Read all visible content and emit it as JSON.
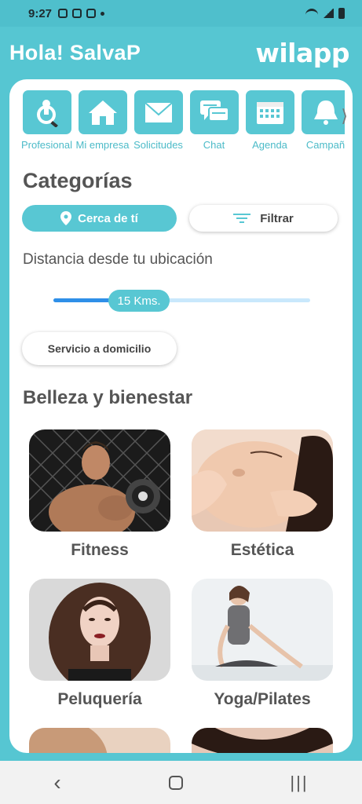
{
  "status": {
    "time": "9:27"
  },
  "header": {
    "greeting": "Hola! SalvaP",
    "logo": "wilapp"
  },
  "nav": {
    "items": [
      {
        "label": "Profesional",
        "icon": "person-search-icon"
      },
      {
        "label": "Mi empresa",
        "icon": "house-icon"
      },
      {
        "label": "Solicitudes",
        "icon": "envelope-icon"
      },
      {
        "label": "Chat",
        "icon": "chat-bubbles-icon"
      },
      {
        "label": "Agenda",
        "icon": "calendar-icon"
      },
      {
        "label": "Campañ",
        "icon": "bell-icon"
      }
    ],
    "more_arrow": "⟩"
  },
  "categories": {
    "title": "Categorías",
    "near_label": "Cerca de tí",
    "filter_label": "Filtrar",
    "distance_label": "Distancia desde tu ubicación",
    "distance_value": "15 Kms.",
    "distance_fraction": 0.22,
    "home_service_label": "Servicio a domicilio"
  },
  "section": {
    "title": "Belleza y bienestar",
    "items": [
      {
        "name": "Fitness"
      },
      {
        "name": "Estética"
      },
      {
        "name": "Peluquería"
      },
      {
        "name": "Yoga/Pilates"
      }
    ]
  },
  "colors": {
    "accent": "#58c7d3",
    "slider_fill": "#2f8fe8",
    "text": "#555555"
  },
  "system_nav": {
    "back": "‹",
    "recents": "|||"
  }
}
